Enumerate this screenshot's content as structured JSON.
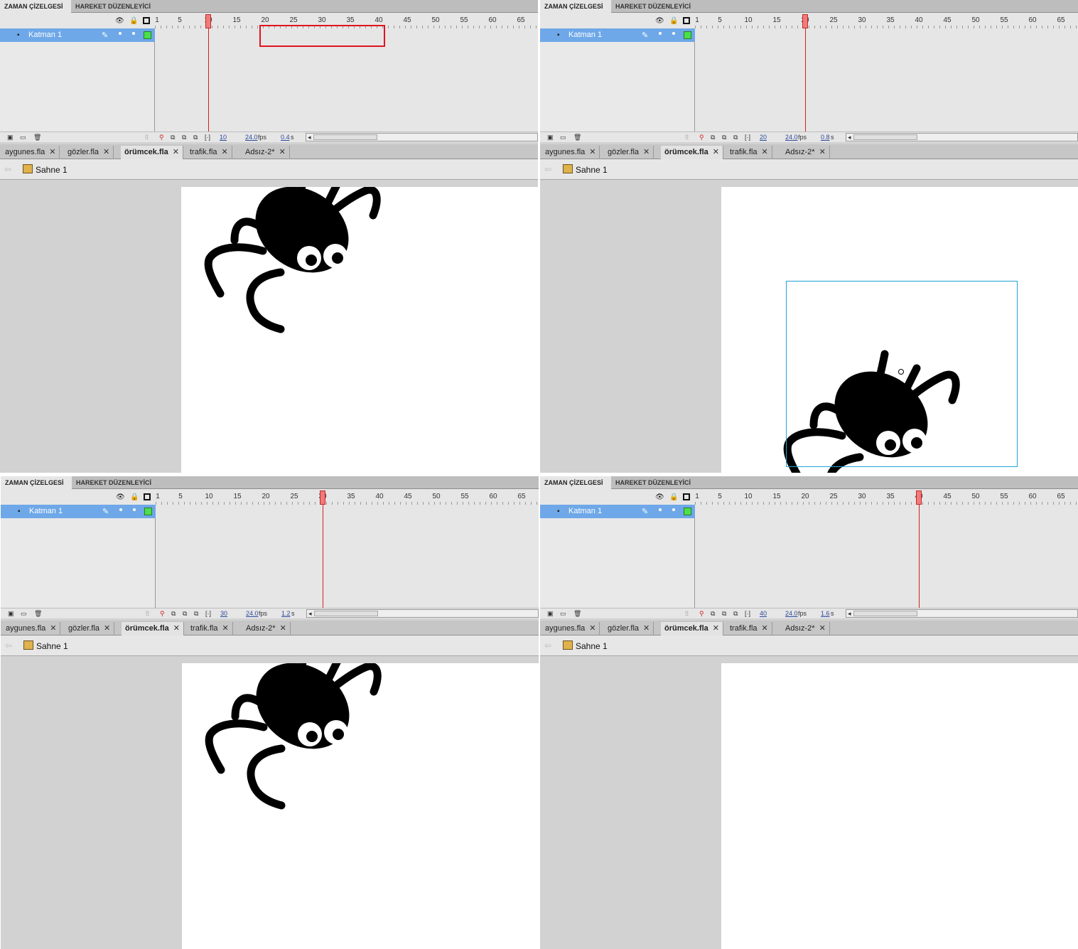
{
  "timeline": {
    "tab_active": "ZAMAN ÇİZELGESİ",
    "tab_other": "HAREKET DÜZENLEYİCİ",
    "ruler_labels": [
      "1",
      "5",
      "10",
      "15",
      "20",
      "25",
      "30",
      "35",
      "40",
      "45",
      "50",
      "55",
      "60",
      "65"
    ],
    "layer_name": "Katman 1",
    "fps": "24.0",
    "fps_unit": "fps",
    "time_unit": "s"
  },
  "doc_tabs": [
    "aygunes.fla",
    "gözler.fla",
    "örümcek.fla",
    "trafik.fla",
    "Adsız-2*"
  ],
  "doc_tab_active": "örümcek.fla",
  "scene_label": "Sahne 1",
  "close_glyph": "✕",
  "panels": [
    {
      "current_frame": "10",
      "current_frame_number": 10,
      "elapsed": "0.4",
      "spider": "top",
      "tween_span_highlight": true
    },
    {
      "current_frame": "20",
      "current_frame_number": 20,
      "elapsed": "0.8",
      "spider": "center-selected",
      "tween_span_highlight": false
    },
    {
      "current_frame": "30",
      "current_frame_number": 30,
      "elapsed": "1.2",
      "spider": "top",
      "tween_span_highlight": false
    },
    {
      "current_frame": "40",
      "current_frame_number": 40,
      "elapsed": "1.6",
      "spider": "none",
      "tween_span_highlight": false
    }
  ],
  "colors": {
    "layer_highlight": "#6ea8e8",
    "tween_fill": "#cfcdfc",
    "playhead": "#d42020",
    "selection": "#23a3d6",
    "highlight_box": "#e0141e"
  },
  "icons": [
    "eye-icon",
    "lock-icon",
    "outline-icon",
    "pencil-icon",
    "scene-icon",
    "back-arrow-icon",
    "trash-icon",
    "new-layer-icon",
    "new-folder-icon",
    "onion-skin-icon"
  ]
}
